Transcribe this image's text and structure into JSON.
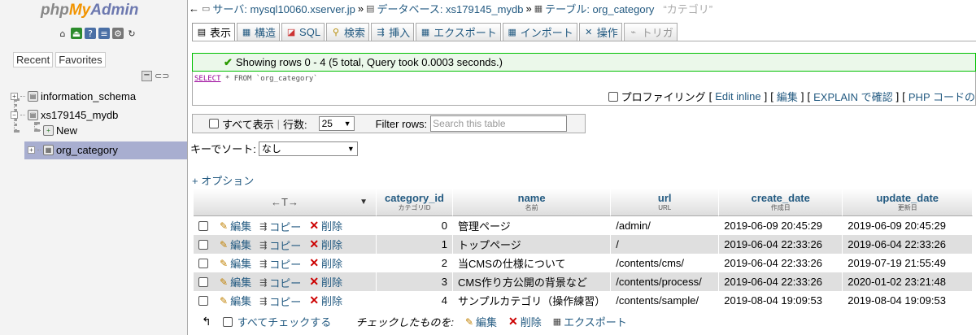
{
  "nav": {
    "logo": {
      "php": "php",
      "my": "My",
      "admin": "Admin"
    },
    "icons": [
      "home-icon",
      "exit-icon",
      "help-icon",
      "docs-icon",
      "settings-icon",
      "reload-icon"
    ],
    "tabs": [
      "Recent",
      "Favorites"
    ],
    "tree": [
      {
        "label": "information_schema"
      },
      {
        "label": "xs179145_mydb"
      },
      {
        "label": "New"
      },
      {
        "label": "org_category"
      }
    ]
  },
  "breadcrumb": {
    "server_label": "サーバ: mysql10060.xserver.jp",
    "db_label": "データベース: xs179145_mydb",
    "table_label": "テーブル: org_category",
    "table_comment": "“カテゴリ”"
  },
  "tabs": [
    {
      "label": "表示",
      "icon": "browse-icon"
    },
    {
      "label": "構造",
      "icon": "structure-icon"
    },
    {
      "label": "SQL",
      "icon": "sql-icon"
    },
    {
      "label": "検索",
      "icon": "search-icon"
    },
    {
      "label": "挿入",
      "icon": "insert-icon"
    },
    {
      "label": "エクスポート",
      "icon": "export-icon"
    },
    {
      "label": "インポート",
      "icon": "import-icon"
    },
    {
      "label": "操作",
      "icon": "operations-icon"
    },
    {
      "label": "トリガ",
      "icon": "triggers-icon"
    }
  ],
  "message": "Showing rows 0 - 4 (5 total, Query took 0.0003 seconds.)",
  "sql": {
    "keyword": "SELECT",
    "rest": " * FROM `org_category`"
  },
  "sql_links": {
    "profiling": "プロファイリング",
    "edit_inline": "Edit inline",
    "edit": "編集",
    "explain": "EXPLAIN で確認",
    "php": "PHP コードの"
  },
  "navbar": {
    "show_all": "すべて表示",
    "rows_label": "行数:",
    "rows_value": "25",
    "filter_label": "Filter rows:",
    "filter_placeholder": "Search this table"
  },
  "sort": {
    "label": "キーでソート:",
    "value": "なし"
  },
  "options_link": "+ オプション",
  "table": {
    "columns": [
      {
        "name": "category_id",
        "comment": "カテゴリID"
      },
      {
        "name": "name",
        "comment": "名前"
      },
      {
        "name": "url",
        "comment": "URL"
      },
      {
        "name": "create_date",
        "comment": "作成日"
      },
      {
        "name": "update_date",
        "comment": "更新日"
      }
    ],
    "action_labels": {
      "edit": "編集",
      "copy": "コピー",
      "delete": "削除"
    },
    "rows": [
      {
        "category_id": "0",
        "name": "管理ページ",
        "url": "/admin/",
        "create_date": "2019-06-09 20:45:29",
        "update_date": "2019-06-09 20:45:29"
      },
      {
        "category_id": "1",
        "name": "トップページ",
        "url": "/",
        "create_date": "2019-06-04 22:33:26",
        "update_date": "2019-06-04 22:33:26"
      },
      {
        "category_id": "2",
        "name": "当CMSの仕様について",
        "url": "/contents/cms/",
        "create_date": "2019-06-04 22:33:26",
        "update_date": "2019-07-19 21:55:49"
      },
      {
        "category_id": "3",
        "name": "CMS作り方公開の背景など",
        "url": "/contents/process/",
        "create_date": "2019-06-04 22:33:26",
        "update_date": "2020-01-02 23:21:48"
      },
      {
        "category_id": "4",
        "name": "サンプルカテゴリ（操作練習）",
        "url": "/contents/sample/",
        "create_date": "2019-08-04 19:09:53",
        "update_date": "2019-08-04 19:09:53"
      }
    ]
  },
  "bottom": {
    "check_all": "すべてチェックする",
    "with_selected": "チェックしたものを:",
    "edit": "編集",
    "delete": "削除",
    "export": "エクスポート"
  }
}
